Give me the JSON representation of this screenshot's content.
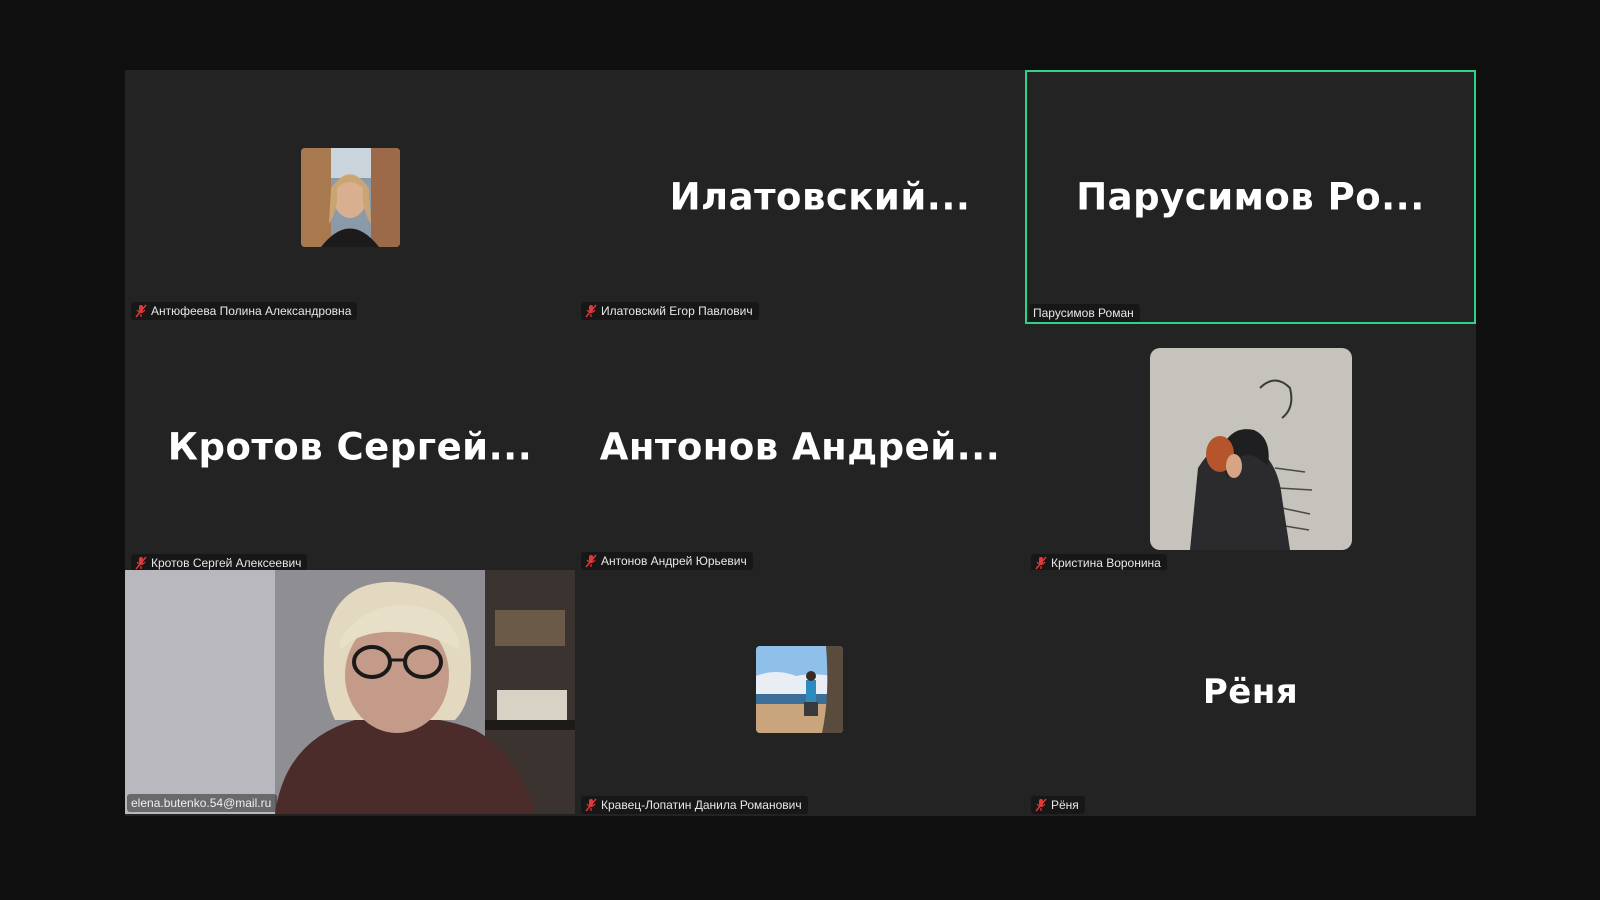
{
  "participants": [
    {
      "display_name": "",
      "nameplate": "Антюфеева Полина Александровна",
      "muted": true
    },
    {
      "display_name": "Илатовский...",
      "nameplate": "Илатовский Егор Павлович",
      "muted": true
    },
    {
      "display_name": "Парусимов  Ро...",
      "nameplate": "Парусимов Роман",
      "muted": false,
      "active_speaker": true
    },
    {
      "display_name": "Кротов  Сергей...",
      "nameplate": "Кротов Сергей Алексеевич",
      "muted": true
    },
    {
      "display_name": "Антонов Андрей...",
      "nameplate": "Антонов Андрей Юрьевич",
      "muted": true
    },
    {
      "display_name": "",
      "nameplate": "Кристина Воронина",
      "muted": true
    },
    {
      "display_name": "",
      "nameplate": "elena.butenko.54@mail.ru",
      "muted": false,
      "video_on": true
    },
    {
      "display_name": "",
      "nameplate": "Кравец-Лопатин Данила Романович",
      "muted": true
    },
    {
      "display_name": "Рёня",
      "nameplate": "Рёня",
      "muted": true
    }
  ],
  "colors": {
    "background": "#0f0f0f",
    "tile": "#232323",
    "active_speaker_border": "#2fd28a",
    "mute_icon": "#e03a3a"
  }
}
